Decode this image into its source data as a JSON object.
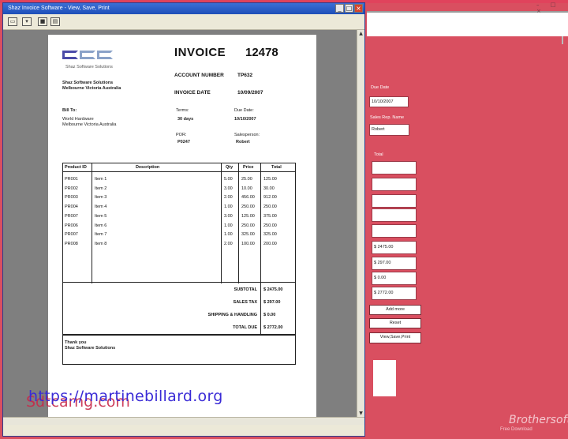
{
  "window": {
    "title": "Shaz Invoice Software - View, Save, Print",
    "minimize": "_",
    "maximize": "□",
    "close": "×"
  },
  "toolbar": {
    "icons": [
      "open-folder-icon",
      "print-setup-icon",
      "save-icon",
      "print-icon"
    ]
  },
  "invoice": {
    "title": "INVOICE",
    "number": "12478",
    "account_label": "ACCOUNT NUMBER",
    "account_value": "TP632",
    "date_label": "INVOICE DATE",
    "date_value": "10/09/2007",
    "company_tagline": "Shaz Software Solutions",
    "company_name": "Shaz Software Solutions",
    "company_addr": "Melbourne Victoria Australia",
    "bill_to_label": "Bill To:",
    "bill_to_name": "World Hardware",
    "bill_to_addr": "Melbourne Victoria Australia",
    "terms_label": "Terms:",
    "terms_value": "30 days",
    "due_label": "Due Date:",
    "due_value": "10/10/2007",
    "por_label": "POR:",
    "por_value": "P0247",
    "sales_label": "Salesperson:",
    "sales_value": "Robert",
    "columns": [
      "Product ID",
      "Description",
      "Qty",
      "Price",
      "Total"
    ],
    "rows": [
      {
        "id": "PR001",
        "desc": "Item 1",
        "qty": "5.00",
        "price": "25.00",
        "total": "125.00"
      },
      {
        "id": "PR002",
        "desc": "Item 2",
        "qty": "3.00",
        "price": "10.00",
        "total": "30.00"
      },
      {
        "id": "PR003",
        "desc": "Item 3",
        "qty": "2.00",
        "price": "456.00",
        "total": "912.00"
      },
      {
        "id": "PR004",
        "desc": "Item 4",
        "qty": "1.00",
        "price": "250.00",
        "total": "250.00"
      },
      {
        "id": "PR007",
        "desc": "Item 5",
        "qty": "3.00",
        "price": "125.00",
        "total": "375.00"
      },
      {
        "id": "PR006",
        "desc": "Item 6",
        "qty": "1.00",
        "price": "250.00",
        "total": "250.00"
      },
      {
        "id": "PR007",
        "desc": "Item 7",
        "qty": "1.00",
        "price": "325.00",
        "total": "325.00"
      },
      {
        "id": "PR008",
        "desc": "Item 8",
        "qty": "2.00",
        "price": "100.00",
        "total": "200.00"
      }
    ],
    "subtotal_label": "SUBTOTAL",
    "subtotal_value": "$ 2475.00",
    "tax_label": "SALES TAX",
    "tax_value": "$ 297.00",
    "shipping_label": "SHIPPING & HANDLING",
    "shipping_value": "$ 0.00",
    "total_label": "TOTAL DUE",
    "total_value": "$ 2772.00",
    "thanks_line1": "Thank you",
    "thanks_line2": "Shaz Software Solutions"
  },
  "watermarks": {
    "site_a": "Sdtcarng.com",
    "site_b": "https://martinebillard.org",
    "brand": "Brothersoft",
    "brand_sub": "Free Download"
  },
  "right_panel": {
    "due_date_label": "Due Date",
    "due_date_value": "10/10/2007",
    "sales_rep_label": "Sales Rep. Name",
    "sales_rep_value": "Robert",
    "total_label": "Total",
    "sum_subtotal": "$ 2475.00",
    "sum_tax": "$ 297.00",
    "sum_shipping": "$ 0.00",
    "sum_total": "$ 2772.00",
    "add_more": "Add more",
    "reset": "Reset",
    "view_save_print": "View,Save,Print",
    "window_controls": "– □ ×"
  },
  "colors": {
    "background": "#d94f60",
    "titlebar": "#1e4fb8",
    "logo_dark": "#4b4ba8",
    "logo_light": "#8aa2c8"
  }
}
